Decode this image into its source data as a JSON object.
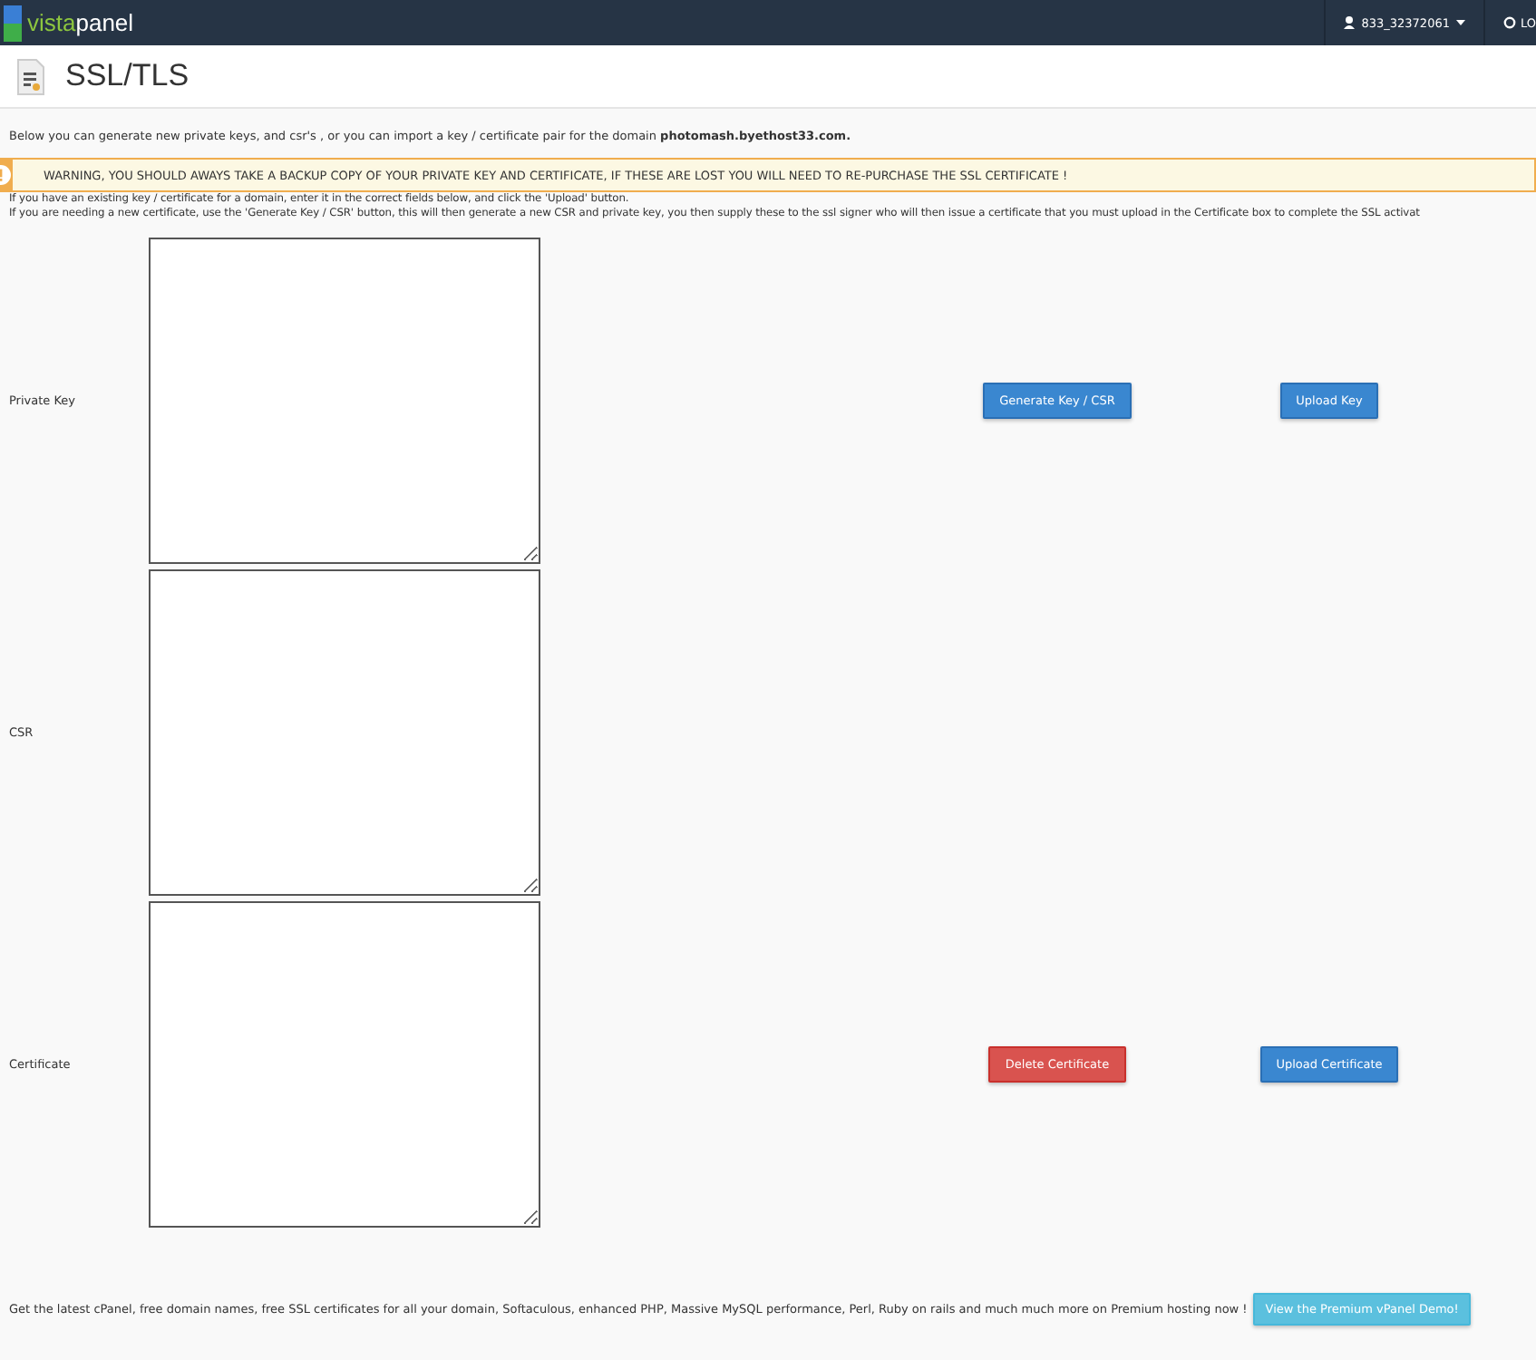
{
  "topbar": {
    "logo_left": "vista",
    "logo_right": "panel",
    "user": "833_32372061",
    "logout": "LO"
  },
  "page": {
    "title": "SSL/TLS"
  },
  "intro": {
    "text": "Below you can generate new private keys, and csr's , or you can import a key / certificate pair for the domain ",
    "domain": "photomash.byethost33.com."
  },
  "warning": "WARNING, YOU SHOULD AWAYS TAKE A BACKUP COPY OF YOUR PRIVATE KEY AND CERTIFICATE, IF THESE ARE LOST YOU WILL NEED TO RE-PURCHASE THE SSL CERTIFICATE !",
  "instructions": [
    "If you have an existing key / certificate for a domain, enter it in the correct fields below, and click the 'Upload' button.",
    "If you are needing a new certificate, use the 'Generate Key / CSR' button, this will then generate a new CSR and private key, you then supply these to the ssl signer who will then issue a certificate that you must upload in the Certificate box to complete the SSL activat"
  ],
  "rows": [
    {
      "label": "Private Key",
      "buttons": [
        {
          "label": "Generate Key / CSR",
          "kind": "primary"
        },
        {
          "label": "Upload Key",
          "kind": "primary"
        }
      ]
    },
    {
      "label": "CSR",
      "buttons": []
    },
    {
      "label": "Certificate",
      "buttons": [
        {
          "label": "Delete Certificate",
          "kind": "danger"
        },
        {
          "label": "Upload Certificate",
          "kind": "primary"
        }
      ]
    }
  ],
  "footer": {
    "text": "Get the latest cPanel, free domain names, free SSL certificates for all your domain, Softaculous, enhanced PHP, Massive MySQL performance, Perl, Ruby on rails and much much more on Premium hosting now !",
    "button": "View the Premium vPanel Demo!"
  }
}
